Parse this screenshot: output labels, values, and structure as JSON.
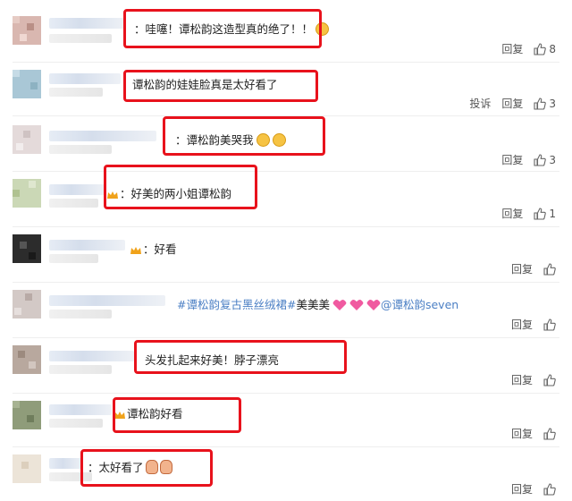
{
  "actions": {
    "reply": "回复",
    "report": "投诉"
  },
  "comments": [
    {
      "text": "哇噻！谭松韵这造型真的绝了！！",
      "likes": "8",
      "emoji": "face-shock-icon"
    },
    {
      "text": "谭松韵的娃娃脸真是太好看了",
      "likes": "3",
      "report": true
    },
    {
      "text": "谭松韵美哭我",
      "likes": "3",
      "emoji": "crying-face-icon"
    },
    {
      "text": "好美的两小姐谭松韵",
      "likes": "1"
    },
    {
      "text": "好看",
      "likes": ""
    },
    {
      "text_link1": "#谭松韵复古黑丝绒裙#",
      "text_mid": "美美美",
      "text_link2": "@谭松韵seven",
      "likes": ""
    },
    {
      "text": "头发扎起来好美！脖子漂亮",
      "likes": ""
    },
    {
      "text": "谭松韵好看",
      "likes": ""
    },
    {
      "text": "太好看了",
      "likes": ""
    }
  ],
  "colors": {
    "highlight": "#e8121c",
    "link": "#4b7fc4"
  }
}
